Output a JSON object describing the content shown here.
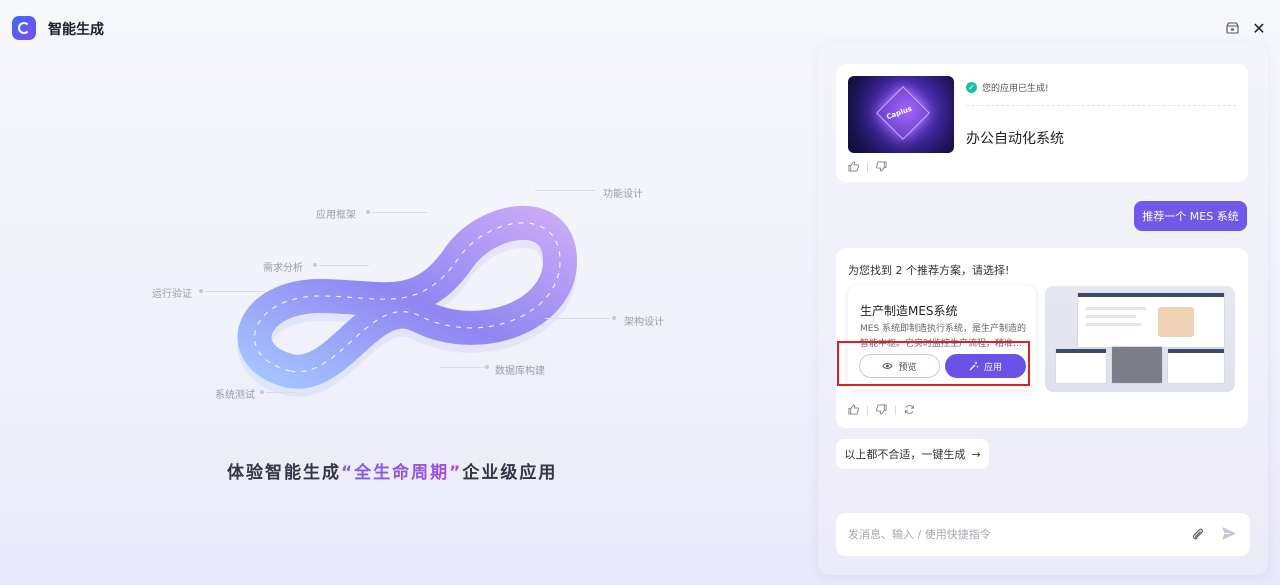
{
  "header": {
    "title": "智能生成",
    "logo_icon": "app-logo-icon",
    "store_icon": "store-icon",
    "close_glyph": "✕"
  },
  "hero": {
    "stages": [
      "功能设计",
      "应用框架",
      "需求分析",
      "运行验证",
      "架构设计",
      "数据库构建",
      "系统测试"
    ],
    "title_prefix": "体验智能生成",
    "title_highlight": "“全生命周期”",
    "title_suffix": "企业级应用"
  },
  "chat": {
    "app_card": {
      "status": "您的应用已生成!",
      "app_name": "办公自动化系统",
      "thumb_text": "Caplus"
    },
    "user_message": "推荐一个 MES 系统",
    "recommend": {
      "intro": "为您找到 2 个推荐方案，请选择!",
      "solution": {
        "name": "生产制造MES系统",
        "description": "MES 系统即制造执行系统，是生产制造的智能中枢。它实时监控生产流程，精准…",
        "preview_label": "预览",
        "apply_label": "应用"
      }
    },
    "generate_button": "以上都不合适，一键生成",
    "generate_arrow": "→",
    "input": {
      "placeholder": "发消息、输入 / 使用快捷指令",
      "value": ""
    }
  },
  "colors": {
    "accent": "#6a52e6",
    "user_bubble": "#7158e8",
    "success": "#1bbfa3",
    "highlight_box": "#e02020"
  }
}
